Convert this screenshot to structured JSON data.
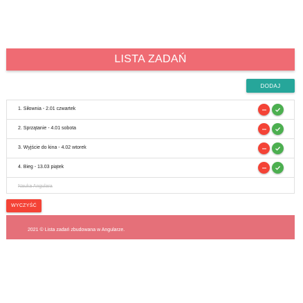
{
  "header": {
    "title": "LISTA ZADAŃ"
  },
  "toolbar": {
    "add_label": "DODAJ"
  },
  "tasks": [
    {
      "label": "1. Siłownia - 2.01 czwartek"
    },
    {
      "label": "2. Sprzątanie - 4.01 sobota"
    },
    {
      "label": "3. Wyjście do kina - 4.02 wtorek"
    },
    {
      "label": "4. Bieg - 13.03 piątek"
    }
  ],
  "done_tasks": [
    {
      "label": "Nauka Angulara"
    }
  ],
  "actions": {
    "clear_label": "WYCZYŚĆ"
  },
  "footer": {
    "text": "2021 © Lista zadań zbudowana w Angularze."
  },
  "icons": {
    "remove": "minus-icon",
    "done": "check-icon"
  },
  "colors": {
    "header": "#ef6b73",
    "add_button": "#26a69a",
    "remove_button": "#f44336",
    "done_button": "#4caf50",
    "clear_button": "#f44336",
    "footer": "#e57079"
  }
}
